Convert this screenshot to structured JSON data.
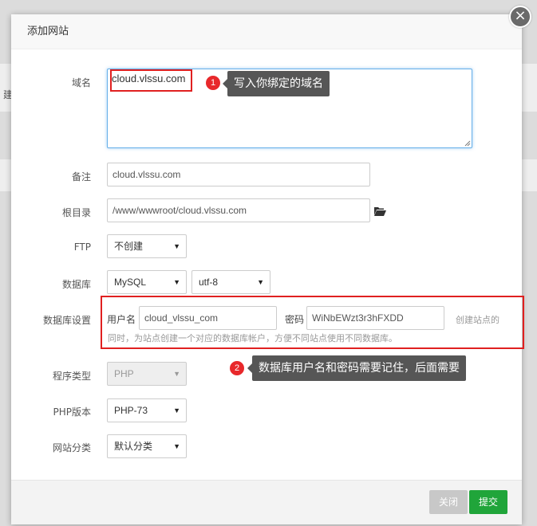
{
  "dialog": {
    "title": "添加网站",
    "close_symbol": "×"
  },
  "background": {
    "side_char": "建"
  },
  "form": {
    "domain": {
      "label": "域名",
      "value": "cloud.vlssu.com"
    },
    "remark": {
      "label": "备注",
      "value": "cloud.vlssu.com"
    },
    "root_dir": {
      "label": "根目录",
      "value": "/www/wwwroot/cloud.vlssu.com"
    },
    "ftp": {
      "label": "FTP",
      "selected": "不创建"
    },
    "database": {
      "label": "数据库",
      "type_selected": "MySQL",
      "charset_selected": "utf-8"
    },
    "db_settings": {
      "label": "数据库设置",
      "username_label": "用户名",
      "username_value": "cloud_vlssu_com",
      "password_label": "密码",
      "password_value": "WiNbEWzt3r3hFXDD",
      "hint_right": "创建站点的",
      "hint_line2": "同时，为站点创建一个对应的数据库帐户，方便不同站点使用不同数据库。"
    },
    "program_type": {
      "label": "程序类型",
      "selected": "PHP"
    },
    "php_version": {
      "label": "PHP版本",
      "selected": "PHP-73"
    },
    "site_category": {
      "label": "网站分类",
      "selected": "默认分类"
    }
  },
  "annotations": {
    "badge1": "1",
    "tip1": "写入你绑定的域名",
    "badge2": "2",
    "tip2": "数据库用户名和密码需要记住，后面需要"
  },
  "footer": {
    "close_label": "关闭",
    "submit_label": "提交"
  },
  "colors": {
    "accent_green": "#20a53a",
    "annotation_red": "#e02020",
    "focus_blue": "#66afe9"
  }
}
